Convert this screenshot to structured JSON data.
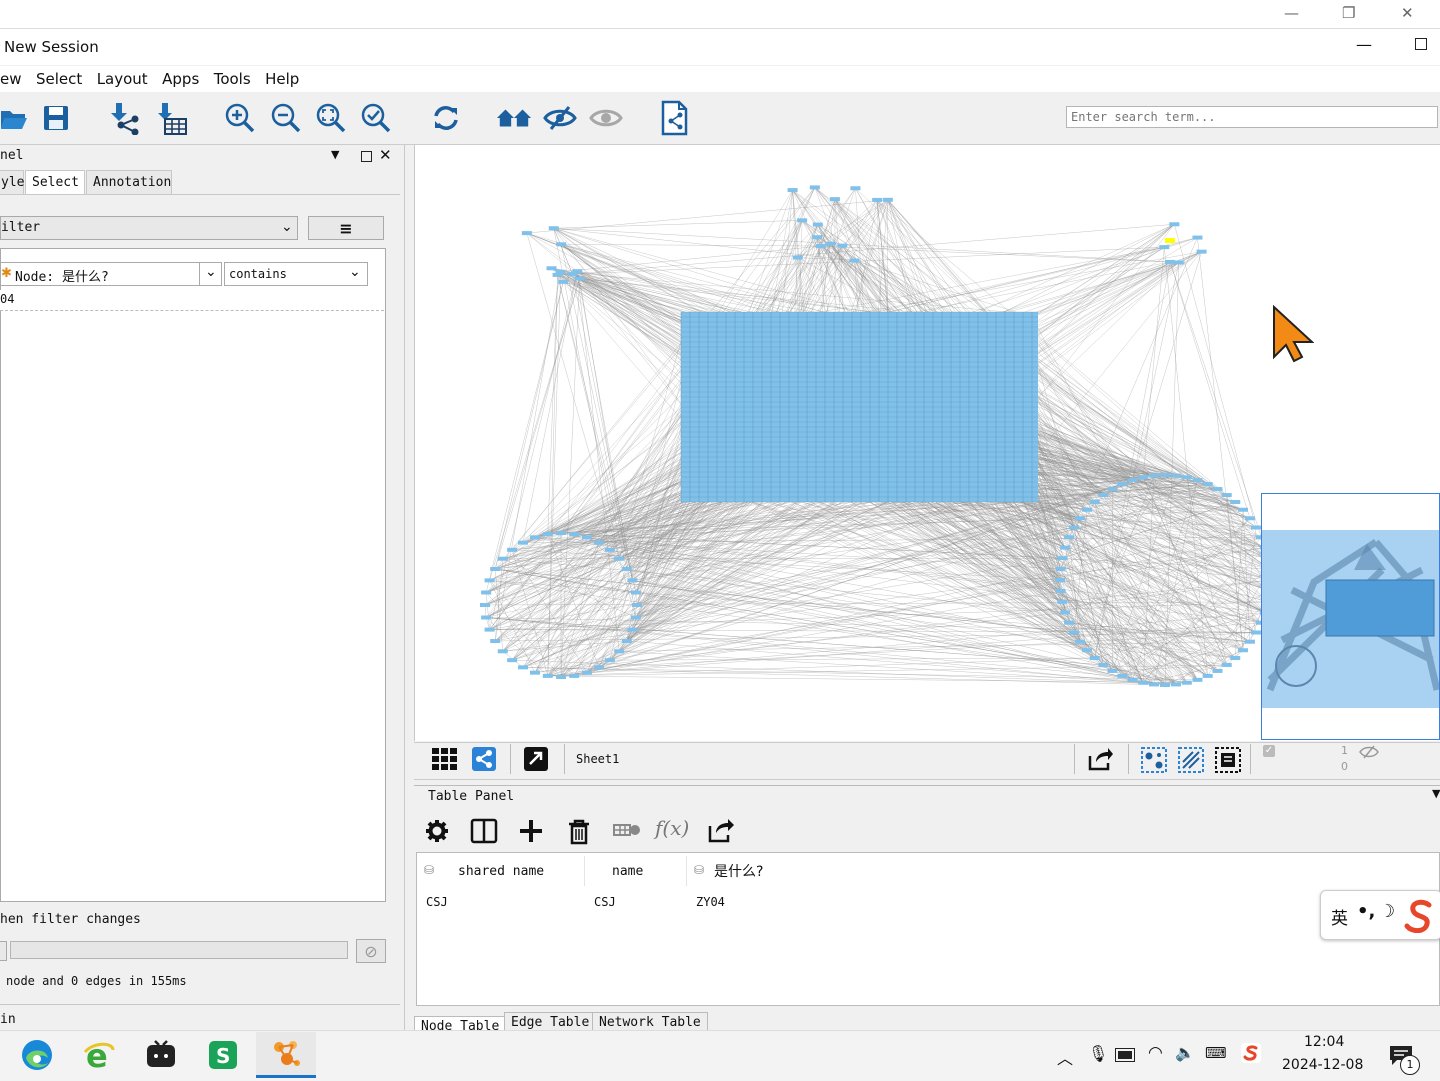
{
  "window": {
    "title": "New Session"
  },
  "menu": [
    "ew",
    "Select",
    "Layout",
    "Apps",
    "Tools",
    "Help"
  ],
  "search": {
    "placeholder": "Enter search term..."
  },
  "left_panel": {
    "title": "nel",
    "tabs": [
      "yle",
      "Select",
      "Annotation"
    ],
    "active_tab": "Select",
    "filter_combo": "ilter",
    "node_column": "Node: 是什么?",
    "operator": "contains",
    "value": "04",
    "apply_text": "hen filter changes",
    "result_text": "node and 0 edges in 155ms",
    "footer": "in"
  },
  "network": {
    "sheet_name": "Sheet1",
    "counts_top": "1",
    "counts_bottom": "0",
    "colors": {
      "node": "#7fc1ea",
      "edge": "#8c8c8c",
      "selected": "#ffff00",
      "birdeye_bg": "#a9d2f2"
    }
  },
  "table_panel": {
    "title": "Table Panel",
    "columns": [
      "shared name",
      "name",
      "是什么?"
    ],
    "rows": [
      [
        "CSJ",
        "CSJ",
        "ZY04"
      ]
    ],
    "tabs": [
      "Node Table",
      "Edge Table",
      "Network Table"
    ]
  },
  "ime": {
    "label": "英"
  },
  "taskbar": {
    "time": "12:04",
    "date": "2024-12-08",
    "notification_count": "1"
  }
}
